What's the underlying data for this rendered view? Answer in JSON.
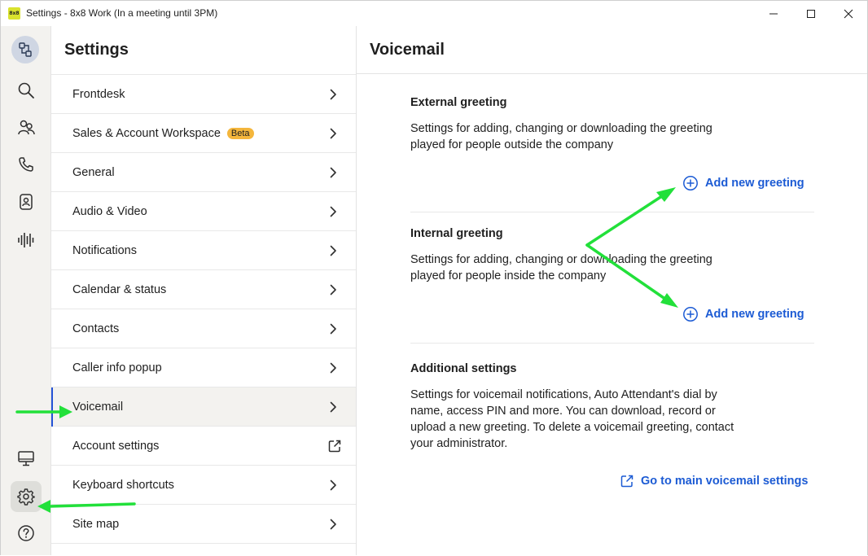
{
  "window": {
    "logo_text": "8x8",
    "title": "Settings - 8x8 Work (In a meeting until 3PM)"
  },
  "rail": {
    "top_icons": [
      "presence-icon",
      "search-icon",
      "contacts-icon",
      "phone-icon",
      "directory-icon",
      "voicemail-wave-icon"
    ],
    "bottom_icons": [
      "desktop-icon",
      "settings-gear-icon",
      "help-icon"
    ]
  },
  "nav": {
    "title": "Settings",
    "items": [
      {
        "label": "Frontdesk",
        "badge": "",
        "type": "chevron"
      },
      {
        "label": "Sales & Account Workspace",
        "badge": "Beta",
        "type": "chevron"
      },
      {
        "label": "General",
        "badge": "",
        "type": "chevron"
      },
      {
        "label": "Audio & Video",
        "badge": "",
        "type": "chevron"
      },
      {
        "label": "Notifications",
        "badge": "",
        "type": "chevron"
      },
      {
        "label": "Calendar & status",
        "badge": "",
        "type": "chevron"
      },
      {
        "label": "Contacts",
        "badge": "",
        "type": "chevron"
      },
      {
        "label": "Caller info popup",
        "badge": "",
        "type": "chevron"
      },
      {
        "label": "Voicemail",
        "badge": "",
        "type": "chevron",
        "active": true
      },
      {
        "label": "Account settings",
        "badge": "",
        "type": "external"
      },
      {
        "label": "Keyboard shortcuts",
        "badge": "",
        "type": "chevron"
      },
      {
        "label": "Site map",
        "badge": "",
        "type": "chevron"
      }
    ]
  },
  "content": {
    "title": "Voicemail",
    "external": {
      "title": "External greeting",
      "desc": "Settings for adding, changing or downloading the greeting played for people outside the company",
      "action": "Add new greeting"
    },
    "internal": {
      "title": "Internal greeting",
      "desc": "Settings for adding, changing or downloading the greeting played for people inside the company",
      "action": "Add new greeting"
    },
    "additional": {
      "title": "Additional settings",
      "desc": "Settings for voicemail notifications, Auto Attendant's dial by name, access PIN and more. You can download, record or upload a new greeting. To delete a voicemail greeting, contact your administrator.",
      "action": "Go to main voicemail settings"
    }
  },
  "colors": {
    "accent": "#1c5bd4",
    "active_bar": "#2453d6",
    "badge": "#f4b63c",
    "rail_bg": "#f3f2ef",
    "annotation_arrow": "#22e03a"
  }
}
